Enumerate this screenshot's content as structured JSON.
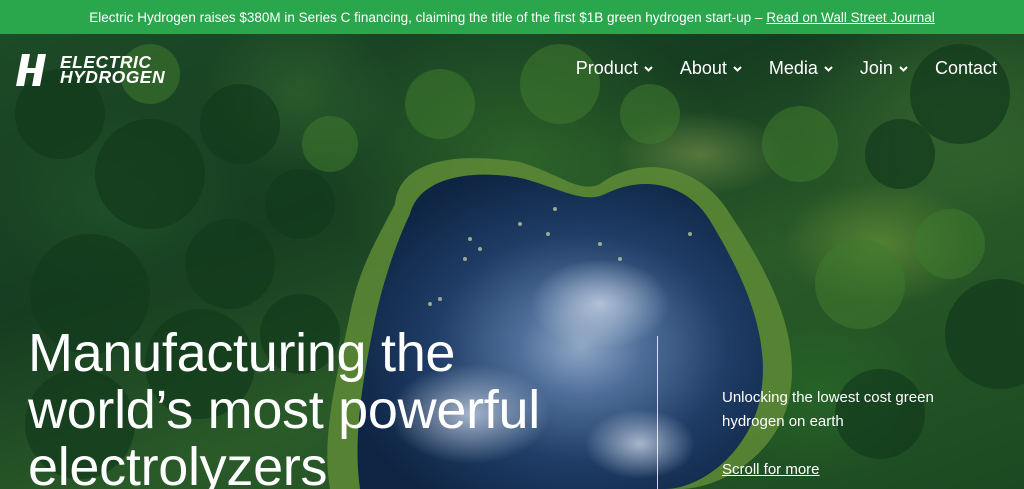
{
  "announcement": {
    "text": "Electric Hydrogen raises $380M in Series C financing, claiming the title of the first $1B green hydrogen start-up –",
    "link_label": "Read on Wall Street Journal",
    "background": "#2aa64c"
  },
  "logo": {
    "line1": "ELECTRIC",
    "line2": "HYDROGEN"
  },
  "nav": {
    "items": [
      {
        "label": "Product",
        "has_dropdown": true
      },
      {
        "label": "About",
        "has_dropdown": true
      },
      {
        "label": "Media",
        "has_dropdown": true
      },
      {
        "label": "Join",
        "has_dropdown": true
      },
      {
        "label": "Contact",
        "has_dropdown": false
      }
    ]
  },
  "hero": {
    "headline_line1": "Manufacturing the",
    "headline_line2": "world’s most powerful",
    "headline_line3": "electrolyzers",
    "tagline": "Unlocking the lowest cost green hydrogen on earth",
    "scroll_label": "Scroll for more"
  },
  "icons": {
    "nav_dropdown": "chevron-down-icon",
    "logo_mark": "slash-bolt-logo-icon"
  }
}
